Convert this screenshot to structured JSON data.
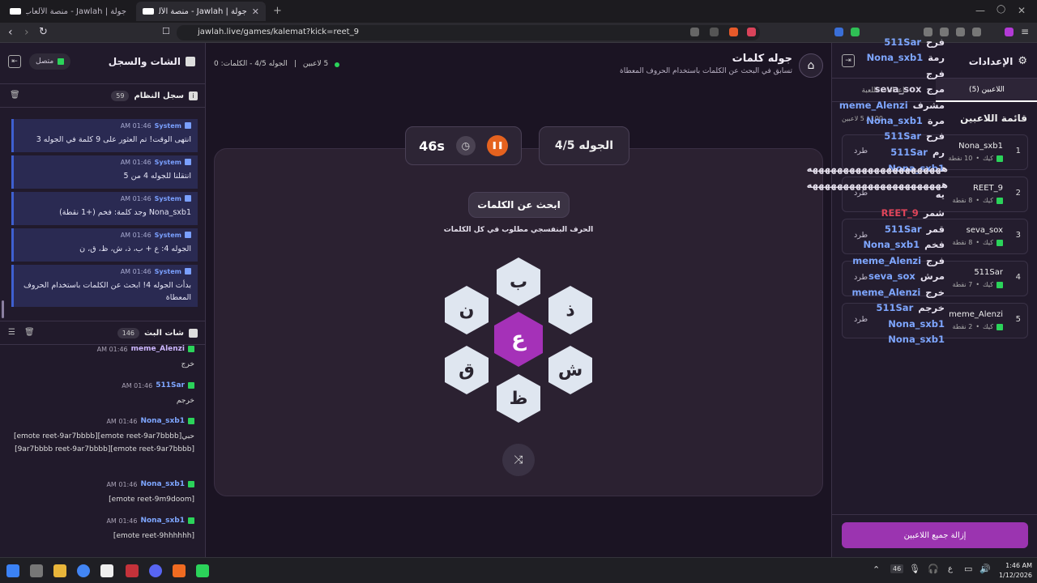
{
  "browser": {
    "tabs": [
      {
        "label": "جولة | Jawlah - منصة الألعاب التفاعلية"
      },
      {
        "label": "جولة | Jawlah - منصة الألعاب التفا"
      }
    ],
    "url": "jawlah.live/games/kalemat?kick=reet_9"
  },
  "left": {
    "title": "الشات والسجل",
    "status": "متصل",
    "system_log": {
      "title": "سجل النظام",
      "count": "59"
    },
    "system_messages": [
      {
        "who": "System",
        "time": "01:46 AM",
        "text": "انتهى الوقت! تم العثور على 9 كلمة في الجوله 3"
      },
      {
        "who": "System",
        "time": "01:46 AM",
        "text": "انتقلنا للجوله 4 من 5"
      },
      {
        "who": "System",
        "time": "01:46 AM",
        "text": "Nona_sxb1 وجد كلمة: فخم (+1 نقطة)"
      },
      {
        "who": "System",
        "time": "01:46 AM",
        "text": "الجوله 4: ع + ب، ذ، ش، ظ، ق، ن"
      },
      {
        "who": "System",
        "time": "01:46 AM",
        "text": "بدأت الجوله 4! ابحث عن الكلمات باستخدام الحروف المعطاة"
      }
    ],
    "stream_chat": {
      "title": "شات البث",
      "count": "146"
    },
    "chat_messages": [
      {
        "who": "meme_Alenzi",
        "time": "01:46 AM",
        "text": "خرج"
      },
      {
        "who": "511Sar",
        "time": "01:46 AM",
        "text": "خرجم"
      },
      {
        "who": "Nona_sxb1",
        "time": "01:46 AM",
        "text": "حبي[emote reet-9ar7bbbb][emote reet-9ar7bbbb][emote reet-9ar7bbbb][9ar7bbbb reet-9ar7bbbb]"
      },
      {
        "who": "Nona_sxb1",
        "time": "01:46 AM",
        "text": "[emote reet-9m9doom]"
      },
      {
        "who": "Nona_sxb1",
        "time": "01:46 AM",
        "text": "[emote reet-9hhhhhh]"
      }
    ]
  },
  "center": {
    "game_title": "جوله كلمات",
    "game_subtitle": "تسابق في البحث عن الكلمات باستخدام الحروف المعطاة",
    "players_count": "5 لاعبين",
    "round_info": "الجوله 4/5 - الكلمات: 0",
    "round_label": "الجوله 4/5",
    "timer": "46s",
    "search_label": "ابحث عن الكلمات",
    "hint": "الحرف البنفسجي مطلوب في كل الكلمات",
    "center_letter": "ع",
    "letters": {
      "top": "ب",
      "top_right": "ذ",
      "bottom_right": "ش",
      "bottom": "ظ",
      "bottom_left": "ق",
      "top_left": "ن"
    }
  },
  "right": {
    "settings_title": "الإعدادات",
    "tab_players": "اللاعبين (5)",
    "tab_settings": "إعدادات اللعبة",
    "list_title": "قائمة اللاعبين",
    "capacity": "100 / 5 لاعبين",
    "kick_label": "طرد",
    "platform": "كيك",
    "players": [
      {
        "rank": "1",
        "name": "Nona_sxb1",
        "points": "10 نقطة"
      },
      {
        "rank": "2",
        "name": "REET_9",
        "points": "8 نقطة"
      },
      {
        "rank": "3",
        "name": "seva_sox",
        "points": "8 نقطة"
      },
      {
        "rank": "4",
        "name": "511Sar",
        "points": "7 نقطة"
      },
      {
        "rank": "5",
        "name": "meme_Alenzi",
        "points": "2 نقطة"
      }
    ],
    "remove_all": "إزالة جميع اللاعبين"
  },
  "overlay_words": [
    {
      "name": "511Sar",
      "word": "فرح",
      "color": "#7ea6ff"
    },
    {
      "name": "Nona_sxb1",
      "word": "رمة",
      "color": "#7ea6ff"
    },
    {
      "name": "",
      "word": "فرج",
      "color": "#dcd6e6"
    },
    {
      "name": "seva_sox",
      "word": "مرج",
      "color": "#dcd6e6"
    },
    {
      "name": "meme_Alenzi",
      "word": "مشرف",
      "color": "#7ea6ff"
    },
    {
      "name": "Nona_sxb1",
      "word": "مرة",
      "color": "#7ea6ff"
    },
    {
      "name": "511Sar",
      "word": "فرح",
      "color": "#7ea6ff"
    },
    {
      "name": "511Sar",
      "word": "رم",
      "color": "#7ea6ff"
    },
    {
      "name": "Nona_sxb1",
      "word": "",
      "color": "#7ea6ff"
    },
    {
      "name": "",
      "word": "ههههههههههههههههههههههه",
      "color": "#dcd6e6"
    },
    {
      "name": "",
      "word": "ههههههههههههههههههههههه",
      "color": "#dcd6e6"
    },
    {
      "name": "",
      "word": "يه",
      "color": "#dcd6e6"
    },
    {
      "name": "REET_9",
      "word": "شمر",
      "color": "#e0455a"
    },
    {
      "name": "511Sar",
      "word": "قمر",
      "color": "#7ea6ff"
    },
    {
      "name": "Nona_sxb1",
      "word": "فخم",
      "color": "#7ea6ff"
    },
    {
      "name": "meme_Alenzi",
      "word": "فرج",
      "color": "#7ea6ff"
    },
    {
      "name": "seva_sox",
      "word": "مرش",
      "color": "#7ea6ff"
    },
    {
      "name": "meme_Alenzi",
      "word": "خرج",
      "color": "#7ea6ff"
    },
    {
      "name": "511Sar",
      "word": "خرجم",
      "color": "#7ea6ff"
    },
    {
      "name": "Nona_sxb1",
      "word": "",
      "color": "#7ea6ff"
    },
    {
      "name": "Nona_sxb1",
      "word": "",
      "color": "#7ea6ff"
    }
  ],
  "taskbar": {
    "time": "1:46 AM",
    "date": "1/12/2026",
    "lang": "ع",
    "badge": "46"
  }
}
